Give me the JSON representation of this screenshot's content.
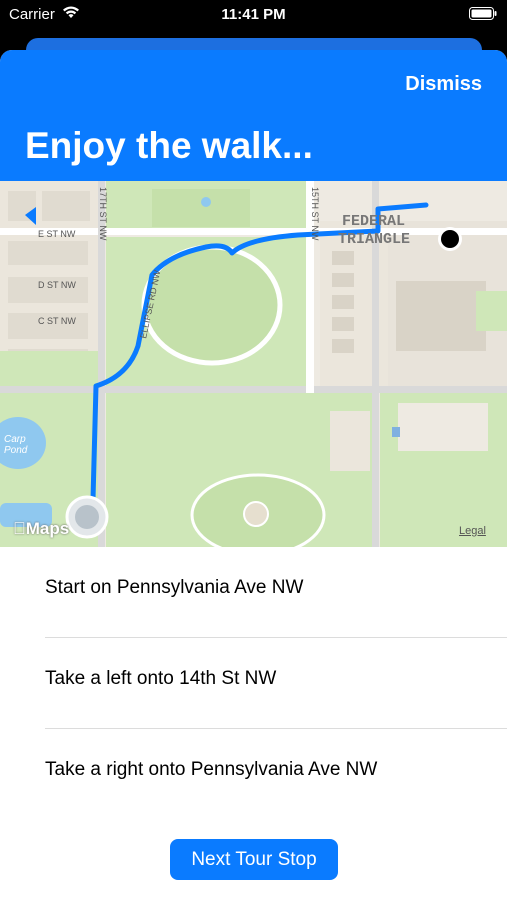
{
  "status_bar": {
    "carrier": "Carrier",
    "time": "11:41 PM"
  },
  "header": {
    "dismiss_label": "Dismiss",
    "title": "Enjoy the walk..."
  },
  "map": {
    "street_labels": {
      "e_st": "E ST NW",
      "d_st": "D ST NW",
      "c_st": "C ST NW",
      "seventeenth_st": "17TH ST NW",
      "fifteenth_st": "15TH ST NW",
      "ellipse_rd": "ELLIPSE RD NW"
    },
    "area_labels": {
      "federal": "FEDERAL",
      "triangle": "TRIANGLE",
      "carp_pond_1": "Carp",
      "carp_pond_2": "Pond"
    },
    "logo_text": "Maps",
    "legal": "Legal",
    "colors": {
      "route": "#0a7bff",
      "park": "#cfe7b8",
      "water": "#8fc8ef"
    }
  },
  "directions": [
    {
      "text": "Start on Pennsylvania Ave NW"
    },
    {
      "text": "Take a left onto 14th St NW"
    },
    {
      "text": "Take a right onto Pennsylvania Ave NW"
    }
  ],
  "next_button_label": "Next Tour Stop"
}
